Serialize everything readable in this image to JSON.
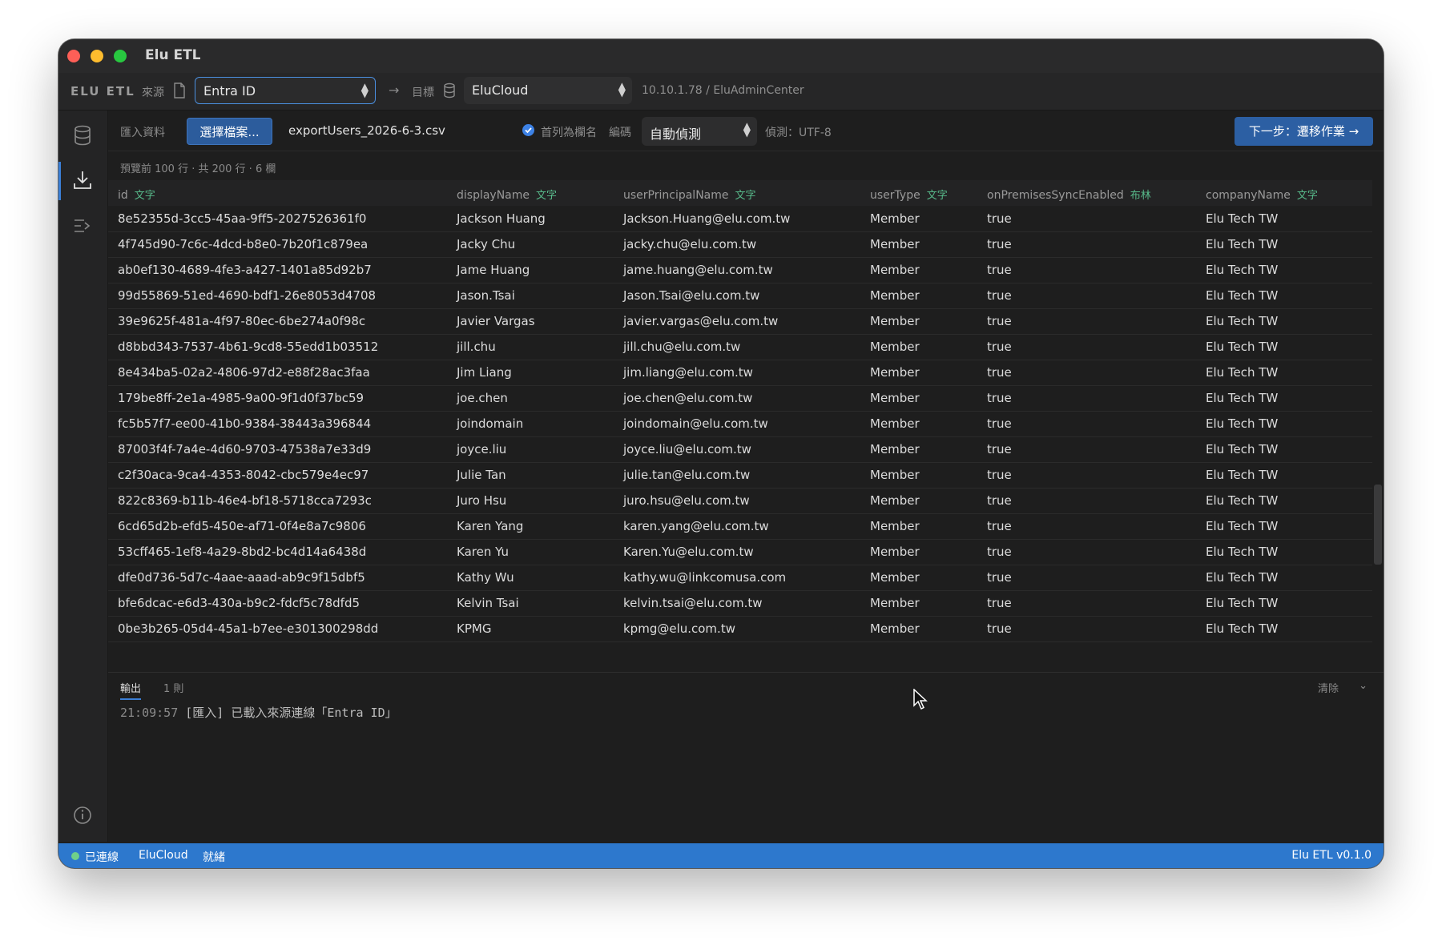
{
  "window": {
    "title": "Elu ETL"
  },
  "toolbar": {
    "brand": "ELU ETL",
    "source_label": "來源",
    "source_value": "Entra ID",
    "arrow": "→",
    "target_label": "目標",
    "target_value": "EluCloud",
    "host": "10.10.1.78 / EluAdminCenter"
  },
  "import": {
    "label": "匯入資料",
    "choose_button": "選擇檔案...",
    "filename": "exportUsers_2026-6-3.csv",
    "header_checkbox_label": "首列為欄名",
    "header_checked": true,
    "encoding_label": "編碼",
    "encoding_value": "自動偵測",
    "detected": "偵測：UTF-8",
    "next_button": "下一步：遷移作業 →"
  },
  "preview": {
    "info": "預覽前 100 行 · 共 200 行 · 6 欄",
    "columns": [
      {
        "name": "id",
        "type": "文字"
      },
      {
        "name": "displayName",
        "type": "文字"
      },
      {
        "name": "userPrincipalName",
        "type": "文字"
      },
      {
        "name": "userType",
        "type": "文字"
      },
      {
        "name": "onPremisesSyncEnabled",
        "type": "布林"
      },
      {
        "name": "companyName",
        "type": "文字"
      }
    ],
    "rows": [
      [
        "8e52355d-3cc5-45aa-9ff5-2027526361f0",
        "Jackson Huang",
        "Jackson.Huang@elu.com.tw",
        "Member",
        "true",
        "Elu Tech TW"
      ],
      [
        "4f745d90-7c6c-4dcd-b8e0-7b20f1c879ea",
        "Jacky Chu",
        "jacky.chu@elu.com.tw",
        "Member",
        "true",
        "Elu Tech TW"
      ],
      [
        "ab0ef130-4689-4fe3-a427-1401a85d92b7",
        "Jame Huang",
        "jame.huang@elu.com.tw",
        "Member",
        "true",
        "Elu Tech TW"
      ],
      [
        "99d55869-51ed-4690-bdf1-26e8053d4708",
        "Jason.Tsai",
        "Jason.Tsai@elu.com.tw",
        "Member",
        "true",
        "Elu Tech TW"
      ],
      [
        "39e9625f-481a-4f97-80ec-6be274a0f98c",
        "Javier Vargas",
        "javier.vargas@elu.com.tw",
        "Member",
        "true",
        "Elu Tech TW"
      ],
      [
        "d8bbd343-7537-4b61-9cd8-55edd1b03512",
        "jill.chu",
        "jill.chu@elu.com.tw",
        "Member",
        "true",
        "Elu Tech TW"
      ],
      [
        "8e434ba5-02a2-4806-97d2-e88f28ac3faa",
        "Jim Liang",
        "jim.liang@elu.com.tw",
        "Member",
        "true",
        "Elu Tech TW"
      ],
      [
        "179be8ff-2e1a-4985-9a00-9f1d0f37bc59",
        "joe.chen",
        "joe.chen@elu.com.tw",
        "Member",
        "true",
        "Elu Tech TW"
      ],
      [
        "fc5b57f7-ee00-41b0-9384-38443a396844",
        "joindomain",
        "joindomain@elu.com.tw",
        "Member",
        "true",
        "Elu Tech TW"
      ],
      [
        "87003f4f-7a4e-4d60-9703-47538a7e33d9",
        "joyce.liu",
        "joyce.liu@elu.com.tw",
        "Member",
        "true",
        "Elu Tech TW"
      ],
      [
        "c2f30aca-9ca4-4353-8042-cbc579e4ec97",
        "Julie Tan",
        "julie.tan@elu.com.tw",
        "Member",
        "true",
        "Elu Tech TW"
      ],
      [
        "822c8369-b11b-46e4-bf18-5718cca7293c",
        "Juro Hsu",
        "juro.hsu@elu.com.tw",
        "Member",
        "true",
        "Elu Tech TW"
      ],
      [
        "6cd65d2b-efd5-450e-af71-0f4e8a7c9806",
        "Karen Yang",
        "karen.yang@elu.com.tw",
        "Member",
        "true",
        "Elu Tech TW"
      ],
      [
        "53cff465-1ef8-4a29-8bd2-bc4d14a6438d",
        "Karen Yu",
        "Karen.Yu@elu.com.tw",
        "Member",
        "true",
        "Elu Tech TW"
      ],
      [
        "dfe0d736-5d7c-4aae-aaad-ab9c9f15dbf5",
        "Kathy Wu",
        "kathy.wu@linkcomusa.com",
        "Member",
        "true",
        "Elu Tech TW"
      ],
      [
        "bfe6dcac-e6d3-430a-b9c2-fdcf5c78dfd5",
        "Kelvin Tsai",
        "kelvin.tsai@elu.com.tw",
        "Member",
        "true",
        "Elu Tech TW"
      ],
      [
        "0be3b265-05d4-45a1-b7ee-e301300298dd",
        "KPMG",
        "kpmg@elu.com.tw",
        "Member",
        "true",
        "Elu Tech TW"
      ]
    ]
  },
  "output": {
    "tab": "輸出",
    "count": "1 則",
    "clear": "清除",
    "chevron": "⌄",
    "log_time": "21:09:57",
    "log_text": "[匯入] 已載入來源連線「Entra ID」"
  },
  "status": {
    "connected": "已連線",
    "target": "EluCloud",
    "state": "就緒",
    "version": "Elu ETL v0.1.0",
    "dot_color": "#6fd08a",
    "bar_color": "#2d78cd"
  },
  "icons": {
    "sidebar": [
      "database-icon",
      "import-icon",
      "migrate-icon",
      "info-icon"
    ]
  }
}
